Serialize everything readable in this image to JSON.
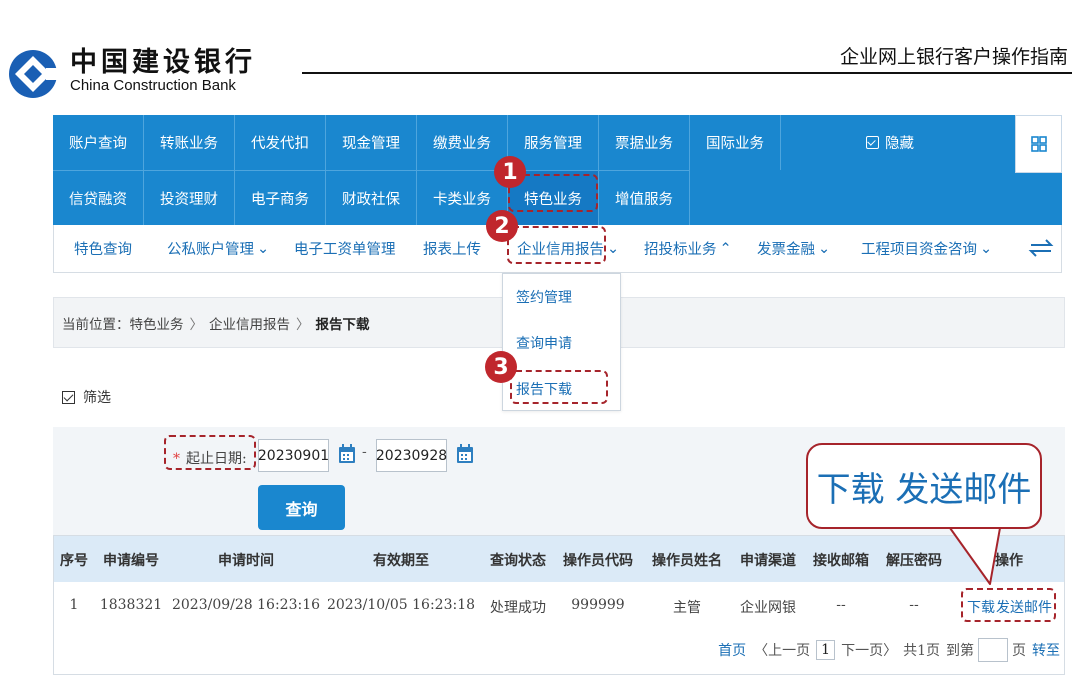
{
  "header": {
    "bank_cn": "中国建设银行",
    "bank_en": "China Construction Bank",
    "guide_title": "企业网上银行客户操作指南"
  },
  "nav": {
    "row1": [
      "账户查询",
      "转账业务",
      "代发代扣",
      "现金管理",
      "缴费业务",
      "服务管理",
      "票据业务",
      "国际业务"
    ],
    "hide_label": "隐藏",
    "row2": [
      "信贷融资",
      "投资理财",
      "电子商务",
      "财政社保",
      "卡类业务",
      "特色业务",
      "增值服务"
    ],
    "active": "特色业务"
  },
  "subnav": {
    "items": [
      "特色查询",
      "公私账户管理",
      "电子工资单管理",
      "报表上传",
      "企业信用报告",
      "招投标业务",
      "发票金融",
      "工程项目资金咨询"
    ],
    "dropdown_marks": [
      "⌄",
      "⌄",
      "⌃",
      "⌄",
      "⌄",
      "⌄"
    ]
  },
  "breadcrumb": {
    "prefix": "当前位置：",
    "level1": "特色业务",
    "level2": "企业信用报告",
    "current": "报告下载",
    "sep": "〉"
  },
  "dropdown": {
    "items": [
      "签约管理",
      "查询申请",
      "报告下载"
    ]
  },
  "filter": {
    "label": "筛选"
  },
  "search": {
    "required_mark": "*",
    "date_label": "起止日期:",
    "start_date": "20230901",
    "dash": "-",
    "end_date": "20230928",
    "query_label": "查询"
  },
  "table": {
    "headers": [
      "序号",
      "申请编号",
      "申请时间",
      "有效期至",
      "查询状态",
      "操作员代码",
      "操作员姓名",
      "申请渠道",
      "接收邮箱",
      "解压密码",
      "操作"
    ],
    "row": {
      "index": "1",
      "app_no": "1838321",
      "apply_time": "2023/09/28 16:23:16",
      "valid_until": "2023/10/05 16:23:18",
      "status": "处理成功",
      "operator_code": "999999",
      "operator_name": "主管",
      "channel": "企业网银",
      "email": "--",
      "password": "--",
      "download": "下载",
      "send_mail": "发送邮件"
    }
  },
  "pager": {
    "first": "首页",
    "prev": "〈上一页",
    "current": "1",
    "next": "下一页〉",
    "total": "共1页",
    "goto": "到第",
    "page_unit": "页",
    "jump": "转至"
  },
  "annotations": {
    "steps": [
      "1",
      "2",
      "3"
    ],
    "callout": "下载 发送邮件"
  },
  "colors": {
    "nav_blue": "#1a87cf",
    "link_blue": "#1b6fb5",
    "annotation_red": "#a6242b",
    "header_row": "#dbeaf7"
  }
}
